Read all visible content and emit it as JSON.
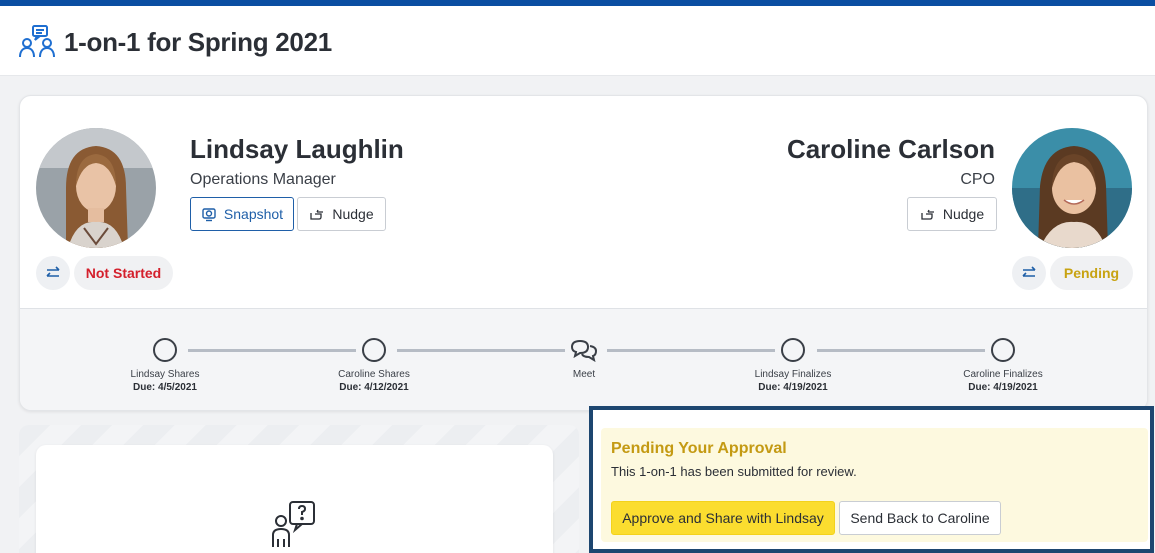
{
  "header": {
    "title": "1-on-1 for Spring 2021",
    "icon": "meeting-people-icon"
  },
  "participants": {
    "left": {
      "name": "Lindsay Laughlin",
      "title": "Operations Manager",
      "snapshot_label": "Snapshot",
      "nudge_label": "Nudge",
      "status": "Not Started",
      "status_color": "#d4202c"
    },
    "right": {
      "name": "Caroline Carlson",
      "title": "CPO",
      "nudge_label": "Nudge",
      "status": "Pending",
      "status_color": "#c8a312"
    }
  },
  "timeline": {
    "steps": [
      {
        "label": "Lindsay Shares",
        "due": "Due: 4/5/2021"
      },
      {
        "label": "Caroline Shares",
        "due": "Due: 4/12/2021"
      },
      {
        "label": "Meet",
        "due": ""
      },
      {
        "label": "Lindsay Finalizes",
        "due": "Due: 4/19/2021"
      },
      {
        "label": "Caroline Finalizes",
        "due": "Due: 4/19/2021"
      }
    ]
  },
  "approval": {
    "title": "Pending Your Approval",
    "message": "This 1-on-1 has been submitted for review.",
    "approve_label": "Approve and Share with Lindsay",
    "send_back_label": "Send Back to Caroline"
  },
  "colors": {
    "accent": "#1f5fa8",
    "top_bar": "#0b4ea2",
    "approve_button": "#fbdd2f",
    "approval_border": "#1d4670"
  }
}
